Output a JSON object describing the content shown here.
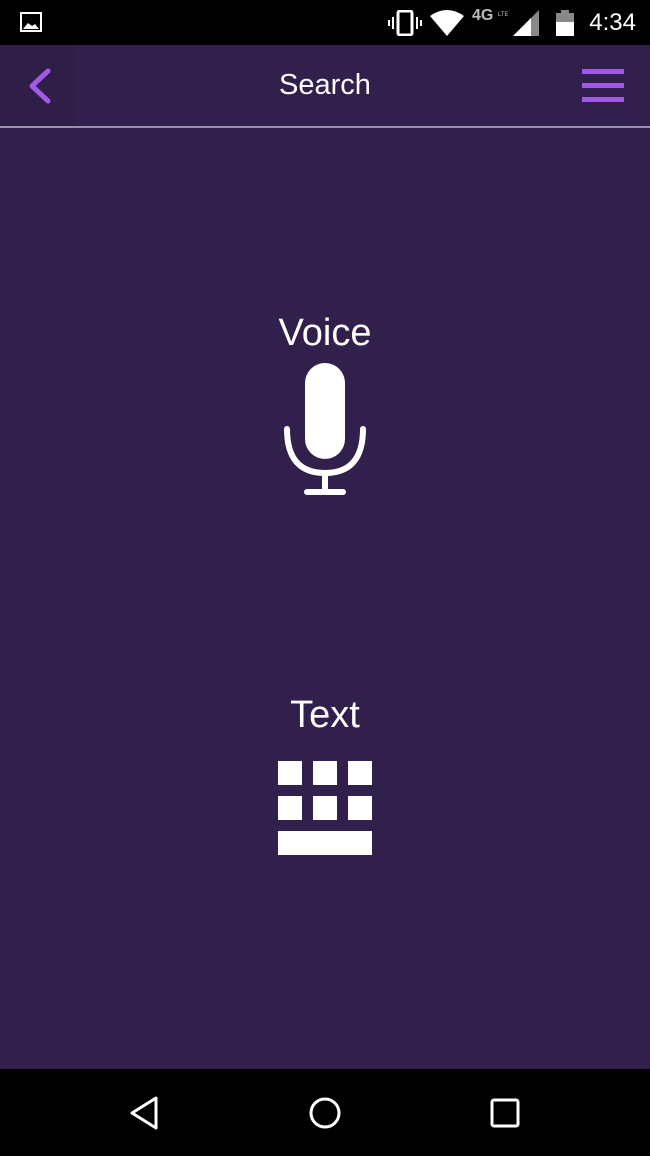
{
  "status_bar": {
    "time": "4:34",
    "network": "4G LTE",
    "icons": [
      "image-notification-icon",
      "vibrate-icon",
      "wifi-icon",
      "signal-icon",
      "battery-icon"
    ]
  },
  "app_bar": {
    "title": "Search",
    "back_icon": "chevron-left-icon",
    "menu_icon": "hamburger-menu-icon",
    "accent_color": "#a259e6"
  },
  "options": [
    {
      "label": "Voice",
      "icon": "microphone-icon"
    },
    {
      "label": "Text",
      "icon": "keyboard-icon"
    }
  ],
  "nav_bar": {
    "buttons": [
      "back",
      "home",
      "recents"
    ]
  },
  "colors": {
    "background": "#311f4c",
    "accent": "#a259e6",
    "text": "#ffffff"
  }
}
